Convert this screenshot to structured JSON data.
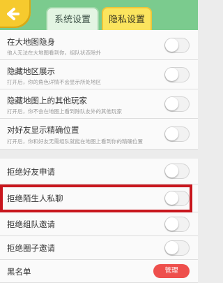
{
  "tabs": [
    {
      "label": "系统设置",
      "active": false
    },
    {
      "label": "隐私设置",
      "active": true
    }
  ],
  "section_a": [
    {
      "title": "在大地图隐身",
      "desc": "他人无法在大地图看到你，组队状态除外",
      "toggle_on": false
    },
    {
      "title": "隐藏地区展示",
      "desc": "打开后，你的角色详情不会显示所处地区",
      "toggle_on": false
    },
    {
      "title": "隐藏地图上的其他玩家",
      "desc": "打开后，你不会在地图上看到除队友外的其他玩家",
      "toggle_on": false
    },
    {
      "title": "对好友显示精确位置",
      "desc": "打开后，你和好友无需组队就能在地图上看到你的精确位置",
      "toggle_on": false
    }
  ],
  "section_b": [
    {
      "title": "拒绝好友申请",
      "toggle_on": false
    },
    {
      "title": "拒绝陌生人私聊",
      "toggle_on": false
    },
    {
      "title": "拒绝组队邀请",
      "toggle_on": false
    },
    {
      "title": "拒绝圈子邀请",
      "toggle_on": false
    }
  ],
  "blacklist": {
    "title": "黑名单",
    "button_label": "管理"
  },
  "colors": {
    "header": "#7bcb8e",
    "active_tab": "#fbe45e",
    "manage_button": "#ee4f4c",
    "highlight_box": "#c8161d"
  }
}
